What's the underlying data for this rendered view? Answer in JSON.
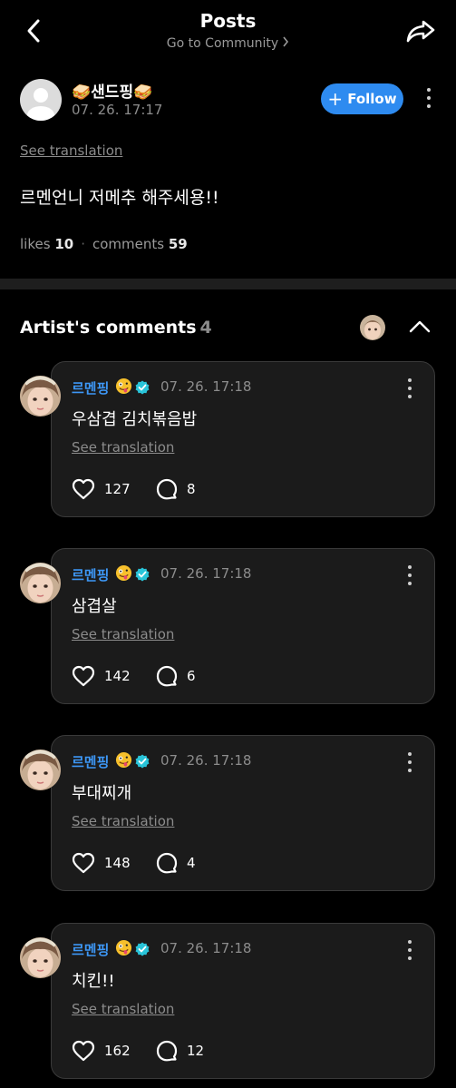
{
  "header": {
    "title": "Posts",
    "subtitle": "Go to Community"
  },
  "post": {
    "author_name": "샌드핑",
    "author_time": "07. 26. 17:17",
    "follow_label": "Follow",
    "see_translation": "See translation",
    "body": "르멘언니 저메추 해주세용!!",
    "likes_label": "likes",
    "likes_count": "10",
    "comments_label": "comments",
    "comments_count": "59"
  },
  "artist_comments": {
    "title": "Artist's comments",
    "count": "4",
    "items": [
      {
        "author": "르멘핑",
        "time": "07. 26. 17:18",
        "text": "우삼겹 김치볶음밥",
        "translate": "See translation",
        "likes": "127",
        "replies": "8"
      },
      {
        "author": "르멘핑",
        "time": "07. 26. 17:18",
        "text": "삼겹살",
        "translate": "See translation",
        "likes": "142",
        "replies": "6"
      },
      {
        "author": "르멘핑",
        "time": "07. 26. 17:18",
        "text": "부대찌개",
        "translate": "See translation",
        "likes": "148",
        "replies": "4"
      },
      {
        "author": "르멘핑",
        "time": "07. 26. 17:18",
        "text": "치킨!!",
        "translate": "See translation",
        "likes": "162",
        "replies": "12"
      }
    ]
  },
  "colors": {
    "accent": "#2e8bf0",
    "artist_name": "#3d97f5",
    "verified": "#29c4d9",
    "card_bg": "#1b1b1b",
    "card_border": "#3a3a3a"
  },
  "icons": [
    "back-arrow-icon",
    "share-icon",
    "chevron-right-icon",
    "plus-icon",
    "more-vertical-icon",
    "chevron-up-icon",
    "verified-badge-icon",
    "heart-icon",
    "comment-bubble-icon",
    "sandwich-emoji",
    "zany-face-emoji"
  ]
}
